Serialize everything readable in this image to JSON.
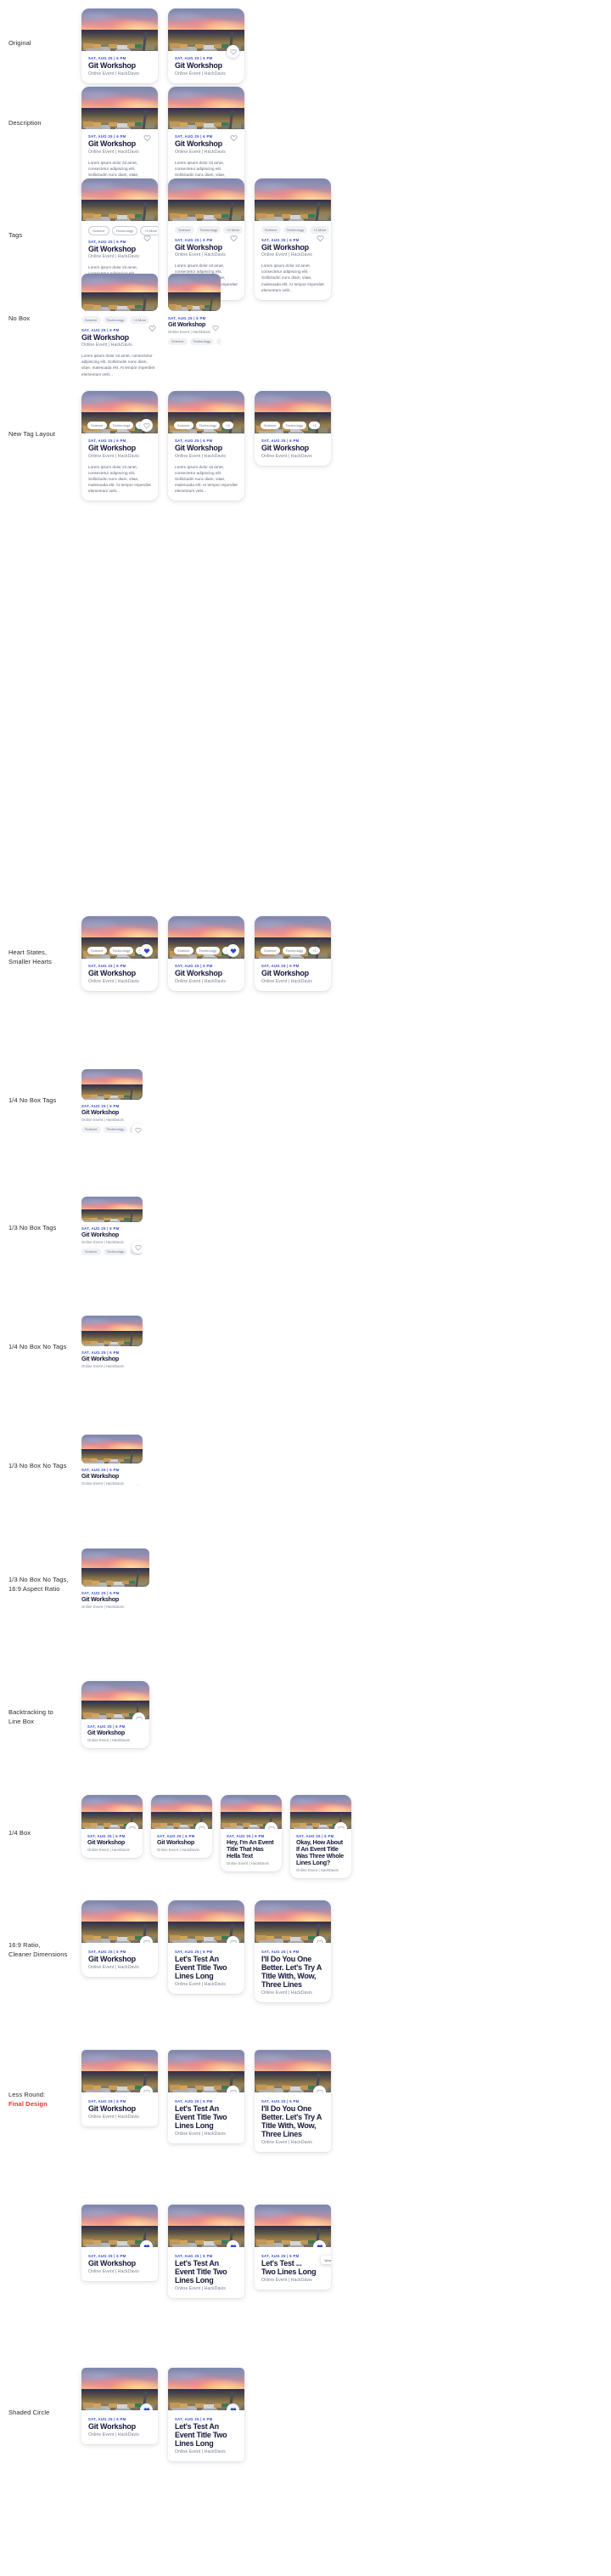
{
  "card": {
    "date": "SAT, AUG 25 | 6 PM",
    "title": "Git Workshop",
    "subtitle": "Online Event | HackDavis",
    "description": "Lorem ipsum dolor sit amet, consectetur adipiscing elit. Sollicitudin nunc diam, vitae, malesuada elit. At tempor imperdiet elementum velit...",
    "tags": [
      "Science",
      "Technology",
      "+2 More"
    ],
    "tags_short": [
      "Science",
      "Technology",
      "+2"
    ],
    "icons": {
      "heart_outline": "heart-outline-icon",
      "heart_filled": "heart-filled-icon"
    },
    "colors": {
      "date": "#2F45D6",
      "title": "#16183A",
      "subtitle": "#7D8296",
      "heart_filled": "#2F45D6",
      "accent_label": "#E8342C"
    }
  },
  "alt_titles": {
    "hey": "Hey, I'm An Event Title That Has Hella Text",
    "okay": "Okay, How About If An Event Title Was Three Whole Lines Long?",
    "test_two": "Let's Test An Event Title Two Lines Long",
    "idu": "I'll Do You One Better. Let's Try A Title With, Wow, Three Lines",
    "clipped": "Let's Test ...\nTwo Lines Long"
  },
  "tooltip": {
    "label": "Unregister"
  },
  "rows": [
    {
      "label": "Original"
    },
    {
      "label": "Description"
    },
    {
      "label": "Tags"
    },
    {
      "label": "No Box"
    },
    {
      "label": "New Tag Layout"
    },
    {
      "label": "Heart States,\nSmaller Hearts"
    },
    {
      "label": "1/4 No Box Tags"
    },
    {
      "label": "1/3 No Box Tags"
    },
    {
      "label": "1/4 No Box No Tags"
    },
    {
      "label": "1/3 No Box No Tags"
    },
    {
      "label": "1/3 No Box No Tags,\n16:9 Aspect Ratio"
    },
    {
      "label": "Backtracking to\nLine Box"
    },
    {
      "label": "1/4 Box"
    },
    {
      "label": "16:9 Ratio,\nCleaner Dimensions"
    },
    {
      "label": "Less Round:",
      "accent": "Final Design"
    },
    {
      "label": ""
    },
    {
      "label": "Shaded Circle"
    }
  ]
}
